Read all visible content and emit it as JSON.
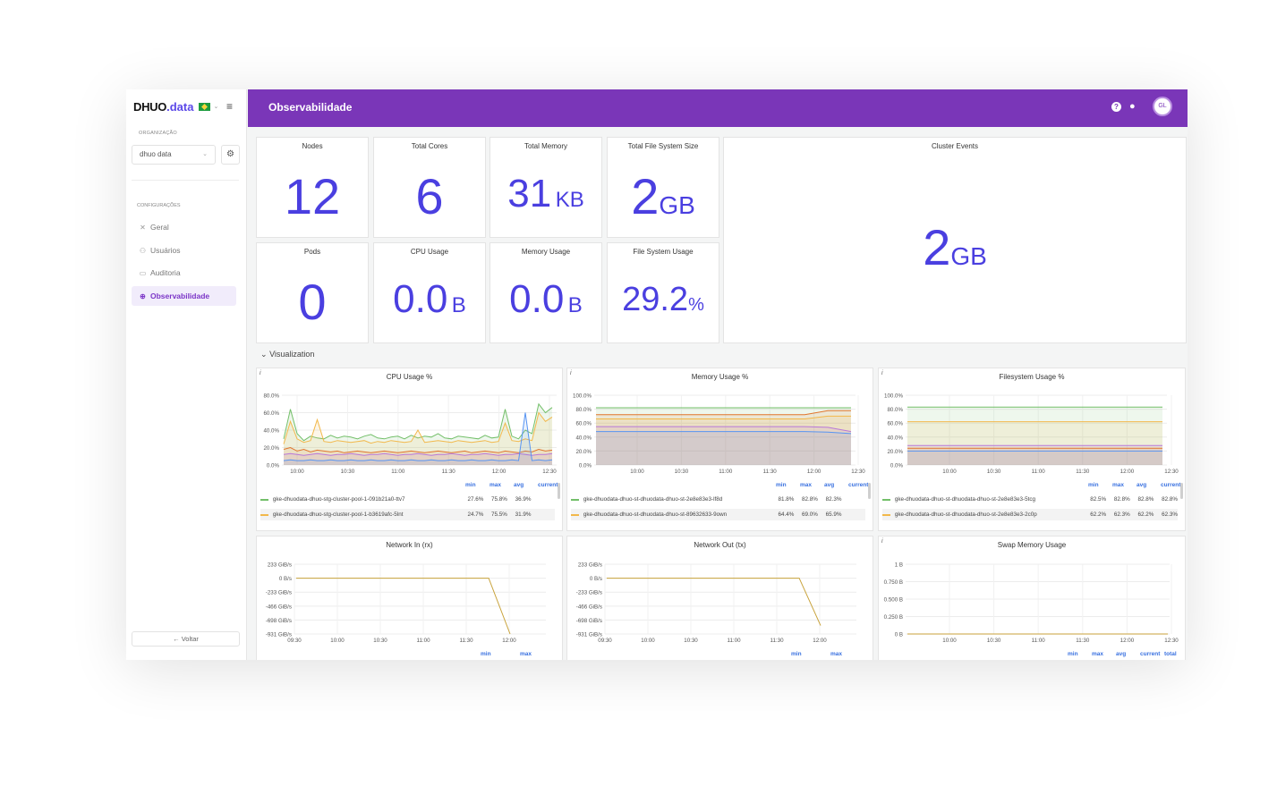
{
  "brand": {
    "name": "DHUO",
    "dot": ".",
    "suffix": "data"
  },
  "sidebar": {
    "org_label": "ORGANIZAÇÃO",
    "org_value": "dhuo data",
    "config_label": "CONFIGURAÇÕES",
    "items": [
      {
        "label": "Geral",
        "icon": "tools-icon"
      },
      {
        "label": "Usuários",
        "icon": "users-icon"
      },
      {
        "label": "Auditoria",
        "icon": "audit-icon"
      },
      {
        "label": "Observabilidade",
        "icon": "observability-icon",
        "active": true
      }
    ],
    "back_label": "← Voltar"
  },
  "header": {
    "title": "Observabilidade",
    "avatar_initials": "GL",
    "color": "#7a36b8"
  },
  "stats": {
    "nodes": {
      "title": "Nodes",
      "value": "12",
      "unit": ""
    },
    "total_cores": {
      "title": "Total Cores",
      "value": "6",
      "unit": ""
    },
    "total_memory": {
      "title": "Total Memory",
      "value": "31",
      "unit": "KB"
    },
    "total_fs": {
      "title": "Total File System Size",
      "value": "2",
      "unit": "GB"
    },
    "cluster_events": {
      "title": "Cluster Events",
      "value": "2",
      "unit": "GB"
    },
    "pods": {
      "title": "Pods",
      "value": "0",
      "unit": ""
    },
    "cpu_usage": {
      "title": "CPU Usage",
      "value": "0.0",
      "unit": "B"
    },
    "memory_usage": {
      "title": "Memory Usage",
      "value": "0.0",
      "unit": "B"
    },
    "fs_usage": {
      "title": "File System Usage",
      "value": "29.2",
      "unit": "%"
    }
  },
  "visualization_label": "Visualization",
  "panels": {
    "cpu": {
      "title": "CPU Usage %",
      "legend_headers": [
        "min",
        "max",
        "avg",
        "current"
      ],
      "legend": [
        {
          "name": "gke-dhuodata-dhuo-stg-cluster-pool-1-091b21a0-ttv7",
          "color": "#73bf69",
          "values": [
            "27.6%",
            "75.8%",
            "36.9%",
            ""
          ]
        },
        {
          "name": "gke-dhuodata-dhuo-stg-cluster-pool-1-b3619afc-5lnt",
          "color": "#f2b84b",
          "values": [
            "24.7%",
            "75.5%",
            "31.9%",
            ""
          ]
        }
      ]
    },
    "memory": {
      "title": "Memory Usage %",
      "legend_headers": [
        "min",
        "max",
        "avg",
        "current"
      ],
      "legend": [
        {
          "name": "gke-dhuodata-dhuo-st-dhuodata-dhuo-st-2e8e83e3-lf8d",
          "color": "#73bf69",
          "values": [
            "81.8%",
            "82.8%",
            "82.3%",
            ""
          ]
        },
        {
          "name": "gke-dhuodata-dhuo-st-dhuodata-dhuo-st-89632633-9own",
          "color": "#f2b84b",
          "values": [
            "64.4%",
            "69.0%",
            "65.9%",
            ""
          ]
        }
      ]
    },
    "filesystem": {
      "title": "Filesystem Usage %",
      "legend_headers": [
        "min",
        "max",
        "avg",
        "current"
      ],
      "legend": [
        {
          "name": "gke-dhuodata-dhuo-st-dhuodata-dhuo-st-2e8e83e3-5tcg",
          "color": "#73bf69",
          "values": [
            "82.5%",
            "82.8%",
            "82.8%",
            "82.8%"
          ]
        },
        {
          "name": "gke-dhuodata-dhuo-st-dhuodata-dhuo-st-2e8e83e3-2c0p",
          "color": "#f2b84b",
          "values": [
            "62.2%",
            "62.3%",
            "62.2%",
            "62.3%"
          ]
        }
      ]
    },
    "net_in": {
      "title": "Network In (rx)",
      "legend_headers": [
        "min",
        "max"
      ]
    },
    "net_out": {
      "title": "Network Out (tx)",
      "legend_headers": [
        "min",
        "max"
      ]
    },
    "swap": {
      "title": "Swap Memory Usage",
      "legend_headers": [
        "min",
        "max",
        "avg",
        "current",
        "total"
      ]
    }
  },
  "chart_data": [
    {
      "type": "area",
      "title": "CPU Usage %",
      "x": [
        "10:00",
        "10:30",
        "11:00",
        "11:30",
        "12:00",
        "12:30"
      ],
      "y_ticks": [
        "80.0%",
        "60.0%",
        "40.0%",
        "20.0%",
        "0.0%"
      ],
      "ylim": [
        0,
        80
      ],
      "series": [
        {
          "name": "gke-dhuodata-dhuo-stg-cluster-pool-1-091b21a0-ttv7",
          "color": "#73bf69",
          "values": [
            30,
            64,
            36,
            28,
            33,
            31,
            30,
            34,
            31,
            33,
            32,
            30,
            33,
            35,
            31,
            30,
            32,
            33,
            30,
            34,
            31,
            33,
            32,
            36,
            31,
            30,
            33,
            32,
            31,
            30,
            34,
            31,
            32,
            64,
            33,
            30,
            40,
            36,
            70,
            60,
            66
          ]
        },
        {
          "name": "gke-dhuodata-dhuo-stg-cluster-pool-1-b3619afc-5lnt",
          "color": "#f2b84b",
          "values": [
            24,
            50,
            30,
            26,
            28,
            52,
            27,
            26,
            28,
            27,
            26,
            27,
            28,
            25,
            27,
            26,
            28,
            27,
            26,
            27,
            40,
            26,
            27,
            28,
            27,
            26,
            28,
            27,
            26,
            27,
            28,
            26,
            27,
            48,
            28,
            27,
            30,
            28,
            60,
            50,
            55
          ]
        },
        {
          "name": "",
          "color": "#e0752d",
          "values": [
            18,
            20,
            16,
            18,
            15,
            17,
            16,
            15,
            16,
            14,
            15,
            16,
            15,
            14,
            15,
            16,
            15,
            14,
            15,
            16,
            15,
            14,
            15,
            16,
            15,
            14,
            15,
            16,
            14,
            15,
            16,
            15,
            14,
            16,
            15,
            14,
            16,
            15,
            18,
            16,
            17
          ]
        },
        {
          "name": "",
          "color": "#b877d9",
          "values": [
            12,
            13,
            12,
            11,
            12,
            13,
            12,
            11,
            12,
            12,
            13,
            12,
            11,
            12,
            12,
            13,
            12,
            11,
            12,
            12,
            13,
            12,
            11,
            12,
            12,
            13,
            12,
            11,
            12,
            12,
            13,
            12,
            11,
            12,
            12,
            13,
            12,
            11,
            12,
            12,
            13
          ]
        },
        {
          "name": "",
          "color": "#5794f2",
          "values": [
            5,
            6,
            5,
            5,
            6,
            5,
            5,
            6,
            5,
            5,
            6,
            5,
            5,
            6,
            5,
            5,
            6,
            5,
            5,
            6,
            5,
            5,
            6,
            5,
            5,
            6,
            5,
            5,
            6,
            5,
            5,
            6,
            5,
            5,
            6,
            5,
            60,
            5,
            6,
            5,
            6
          ]
        }
      ]
    },
    {
      "type": "area",
      "title": "Memory Usage %",
      "x": [
        "10:00",
        "10:30",
        "11:00",
        "11:30",
        "12:00",
        "12:30"
      ],
      "y_ticks": [
        "100.0%",
        "80.0%",
        "60.0%",
        "40.0%",
        "20.0%",
        "0.0%"
      ],
      "ylim": [
        0,
        100
      ],
      "series": [
        {
          "name": "gke-dhuodata-dhuo-st-dhuodata-dhuo-st-2e8e83e3-lf8d",
          "color": "#73bf69",
          "values": [
            82,
            82,
            82,
            82,
            82,
            82,
            82,
            82,
            82,
            82,
            82,
            82
          ]
        },
        {
          "name": "",
          "color": "#e0752d",
          "values": [
            72,
            72,
            72,
            72,
            72,
            72,
            72,
            72,
            72,
            72,
            78,
            78
          ]
        },
        {
          "name": "gke-dhuodata-dhuo-st-dhuodata-dhuo-st-89632633-9own",
          "color": "#f2b84b",
          "values": [
            66,
            66,
            66,
            66,
            66,
            66,
            66,
            66,
            66,
            66,
            70,
            70
          ]
        },
        {
          "name": "",
          "color": "#b877d9",
          "values": [
            55,
            55,
            55,
            55,
            55,
            55,
            55,
            55,
            55,
            55,
            54,
            48
          ]
        },
        {
          "name": "",
          "color": "#5794f2",
          "values": [
            48,
            48,
            48,
            48,
            48,
            48,
            48,
            48,
            48,
            48,
            47,
            45
          ]
        }
      ]
    },
    {
      "type": "area",
      "title": "Filesystem Usage %",
      "x": [
        "10:00",
        "10:30",
        "11:00",
        "11:30",
        "12:00",
        "12:30"
      ],
      "y_ticks": [
        "100.0%",
        "80.0%",
        "60.0%",
        "40.0%",
        "20.0%",
        "0.0%"
      ],
      "ylim": [
        0,
        100
      ],
      "series": [
        {
          "name": "gke-dhuodata-dhuo-st-dhuodata-dhuo-st-2e8e83e3-5tcg",
          "color": "#73bf69",
          "values": [
            83,
            83
          ]
        },
        {
          "name": "gke-dhuodata-dhuo-st-dhuodata-dhuo-st-2e8e83e3-2c0p",
          "color": "#f2b84b",
          "values": [
            62,
            62
          ]
        },
        {
          "name": "",
          "color": "#b877d9",
          "values": [
            28,
            28
          ]
        },
        {
          "name": "",
          "color": "#e0752d",
          "values": [
            24,
            24
          ]
        },
        {
          "name": "",
          "color": "#5794f2",
          "values": [
            20,
            20
          ]
        }
      ]
    },
    {
      "type": "line",
      "title": "Network In (rx)",
      "x": [
        "09:30",
        "10:00",
        "10:30",
        "11:00",
        "11:30",
        "12:00"
      ],
      "y_ticks": [
        "233 GiB/s",
        "0 B/s",
        "-233 GiB/s",
        "-466 GiB/s",
        "-698 GiB/s",
        "-931 GiB/s"
      ],
      "series": [
        {
          "name": "",
          "color": "#c8a23a",
          "values": [
            0,
            0,
            0,
            0,
            0,
            0,
            0,
            0,
            0,
            0,
            -931
          ]
        }
      ]
    },
    {
      "type": "line",
      "title": "Network Out (tx)",
      "x": [
        "09:30",
        "10:00",
        "10:30",
        "11:00",
        "11:30",
        "12:00"
      ],
      "y_ticks": [
        "233 GiB/s",
        "0 B/s",
        "-233 GiB/s",
        "-466 GiB/s",
        "-698 GiB/s",
        "-931 GiB/s"
      ],
      "series": [
        {
          "name": "",
          "color": "#c8a23a",
          "values": [
            0,
            0,
            0,
            0,
            0,
            0,
            0,
            0,
            0,
            0,
            -790
          ]
        }
      ]
    },
    {
      "type": "line",
      "title": "Swap Memory Usage",
      "x": [
        "10:00",
        "10:30",
        "11:00",
        "11:30",
        "12:00",
        "12:30"
      ],
      "y_ticks": [
        "1 B",
        "0.750 B",
        "0.500 B",
        "0.250 B",
        "0 B"
      ],
      "series": [
        {
          "name": "",
          "color": "#c8a23a",
          "values": [
            0,
            0,
            0,
            0,
            0,
            0
          ]
        }
      ]
    }
  ]
}
